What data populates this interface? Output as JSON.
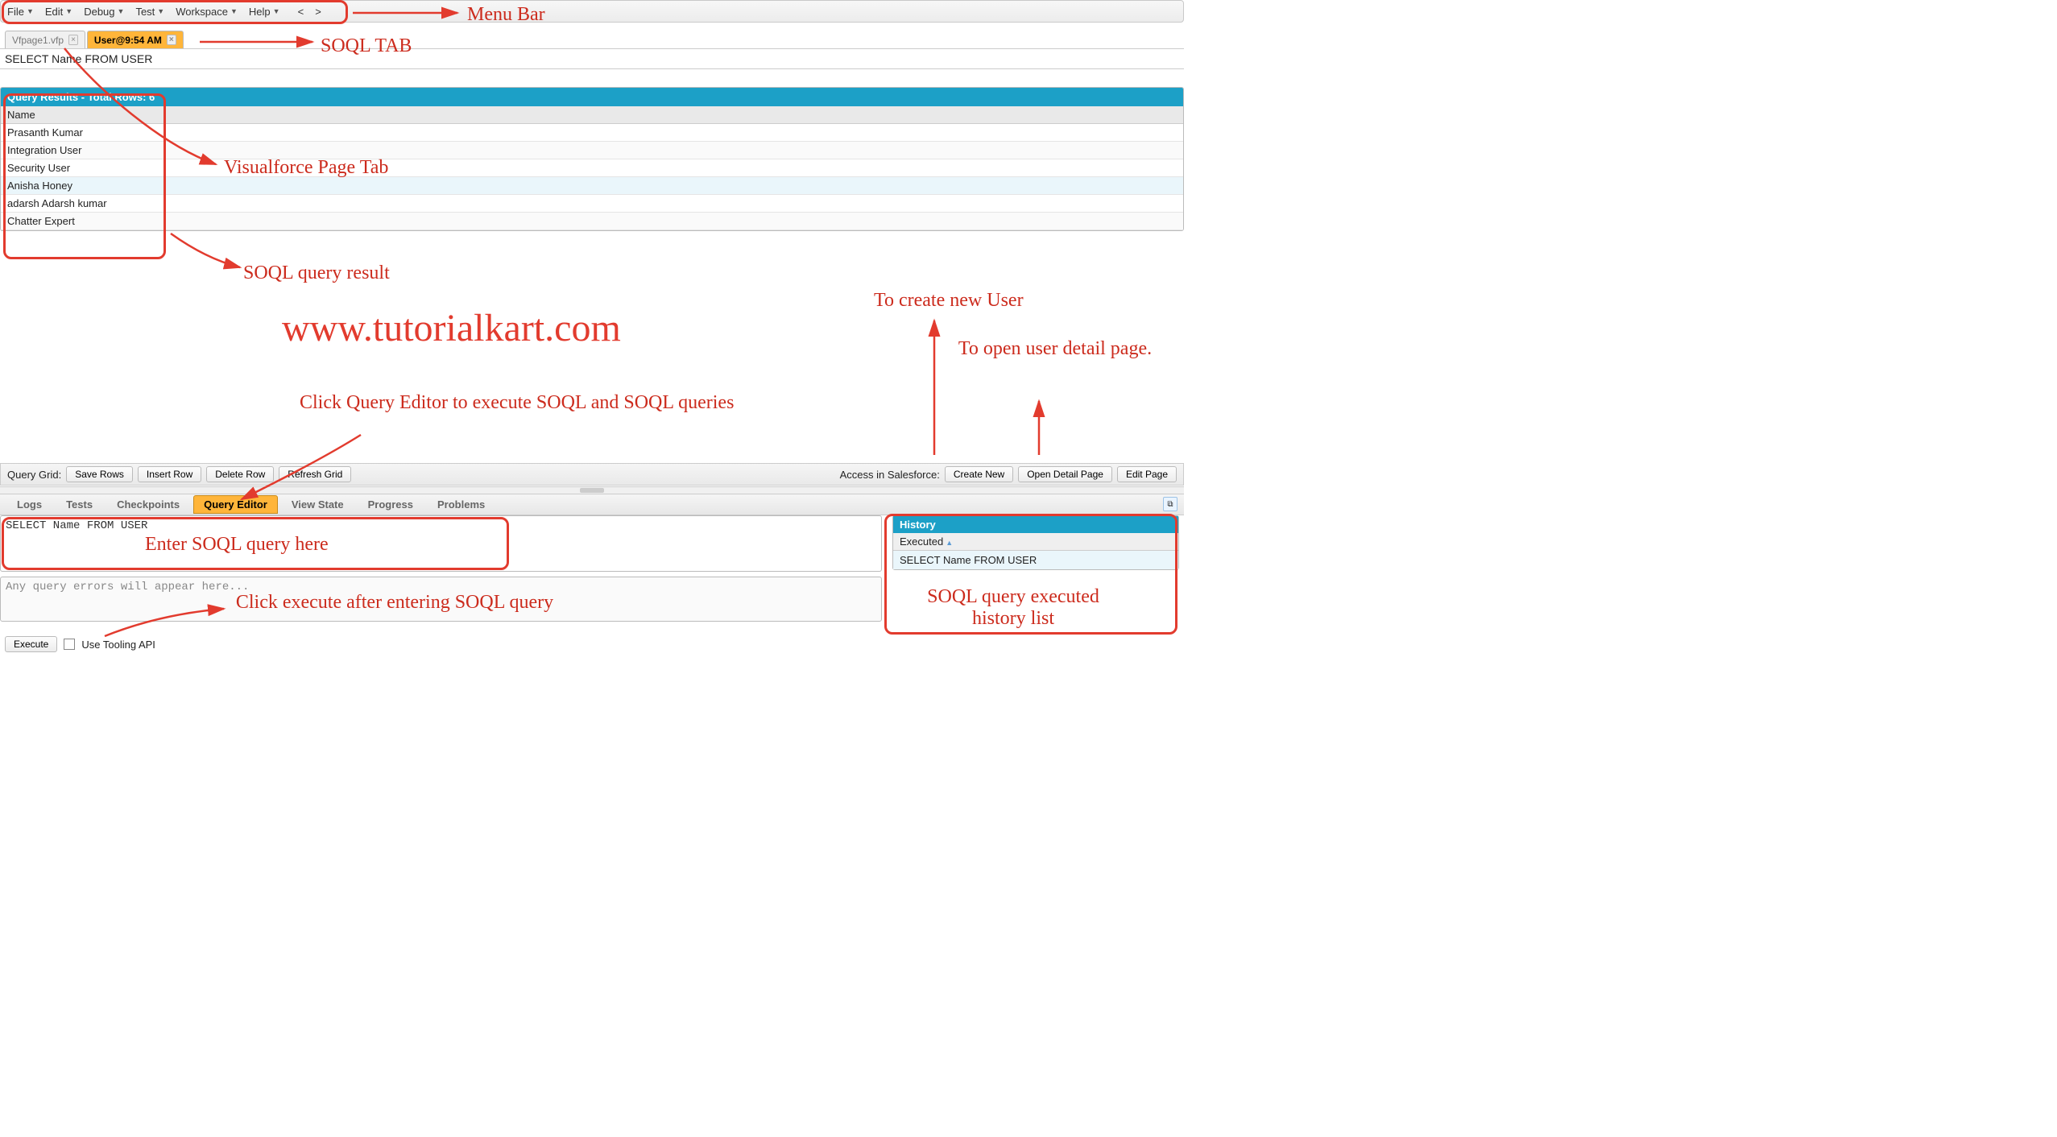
{
  "menu": {
    "items": [
      "File",
      "Edit",
      "Debug",
      "Test",
      "Workspace",
      "Help"
    ],
    "nav_prev": "<",
    "nav_next": ">"
  },
  "tabs": [
    {
      "label": "Vfpage1.vfp",
      "active": false
    },
    {
      "label": "User@9:54 AM",
      "active": true
    }
  ],
  "query_text": "SELECT Name FROM USER",
  "results": {
    "header": "Query Results - Total Rows: 6",
    "column": "Name",
    "rows": [
      "Prasanth Kumar",
      "Integration User",
      "Security User",
      "Anisha Honey",
      "adarsh Adarsh kumar",
      "Chatter Expert"
    ]
  },
  "watermark": "www.tutorialkart.com",
  "grid_toolbar": {
    "label": "Query Grid:",
    "buttons": [
      "Save Rows",
      "Insert Row",
      "Delete Row",
      "Refresh Grid"
    ],
    "right_label": "Access in Salesforce:",
    "right_buttons": [
      "Create New",
      "Open Detail Page",
      "Edit Page"
    ]
  },
  "lower_tabs": [
    "Logs",
    "Tests",
    "Checkpoints",
    "Query Editor",
    "View State",
    "Progress",
    "Problems"
  ],
  "lower_tabs_active_index": 3,
  "editor": {
    "query": "SELECT Name FROM USER",
    "error_placeholder": "Any query errors will appear here..."
  },
  "history": {
    "title": "History",
    "column": "Executed",
    "rows": [
      "SELECT Name FROM USER"
    ]
  },
  "exec": {
    "button": "Execute",
    "checkbox_label": "Use Tooling API"
  },
  "annotations": {
    "menu_bar": "Menu Bar",
    "soql_tab": "SOQL TAB",
    "vf_tab": "Visualforce Page Tab",
    "soql_result": "SOQL query result",
    "create_new": "To create new User",
    "open_detail": "To open user detail page.",
    "query_editor_hint": "Click Query Editor to execute SOQL and SOQL queries",
    "enter_query": "Enter SOQL query here",
    "click_execute": "Click execute after entering SOQL query",
    "history_hint": "SOQL query executed history list"
  }
}
